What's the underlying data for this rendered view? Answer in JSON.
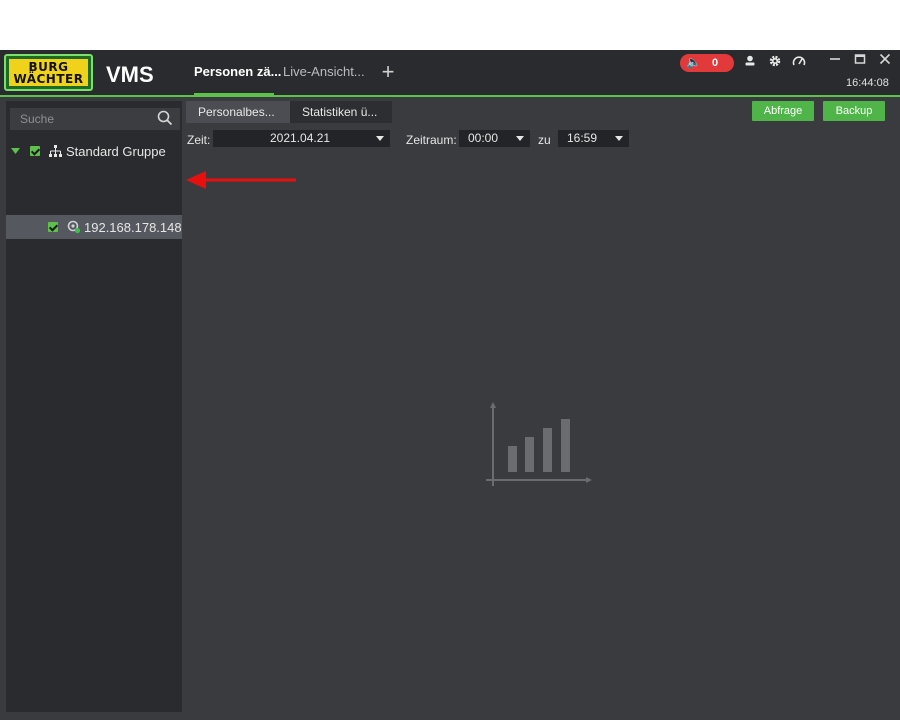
{
  "app": {
    "logo_line1": "BURG",
    "logo_line2": "WÄCHTER",
    "name": "VMS",
    "colors": {
      "accent": "#5cc24a",
      "alarm": "#e23a3a",
      "background": "#3a3b3f"
    }
  },
  "main_tabs": [
    {
      "label": "Personen zä...",
      "active": true
    },
    {
      "label": "Live-Ansicht...",
      "active": false
    }
  ],
  "toolbar": {
    "alarm_icon": "speaker-icon",
    "alarm_count": "0",
    "icons": [
      "user-icon",
      "gear-icon",
      "gauge-icon"
    ],
    "window_icons": [
      "minimize-icon",
      "maximize-icon",
      "close-icon"
    ],
    "clock": "16:44:08"
  },
  "sidebar": {
    "search_placeholder": "Suche",
    "tree": {
      "group_label": "Standard Gruppe",
      "device_label": "192.168.178.148"
    }
  },
  "content": {
    "tabs": [
      {
        "label": "Personalbes...",
        "active": true
      },
      {
        "label": "Statistiken ü...",
        "active": false
      }
    ],
    "buttons": {
      "query": "Abfrage",
      "backup": "Backup"
    },
    "filters": {
      "time_label": "Zeit:",
      "date_value": "2021.04.21",
      "range_label": "Zeitraum:",
      "from_value": "00:00",
      "to_label": "zu",
      "to_value": "16:59"
    },
    "empty_state_icon": "bar-chart-icon"
  }
}
